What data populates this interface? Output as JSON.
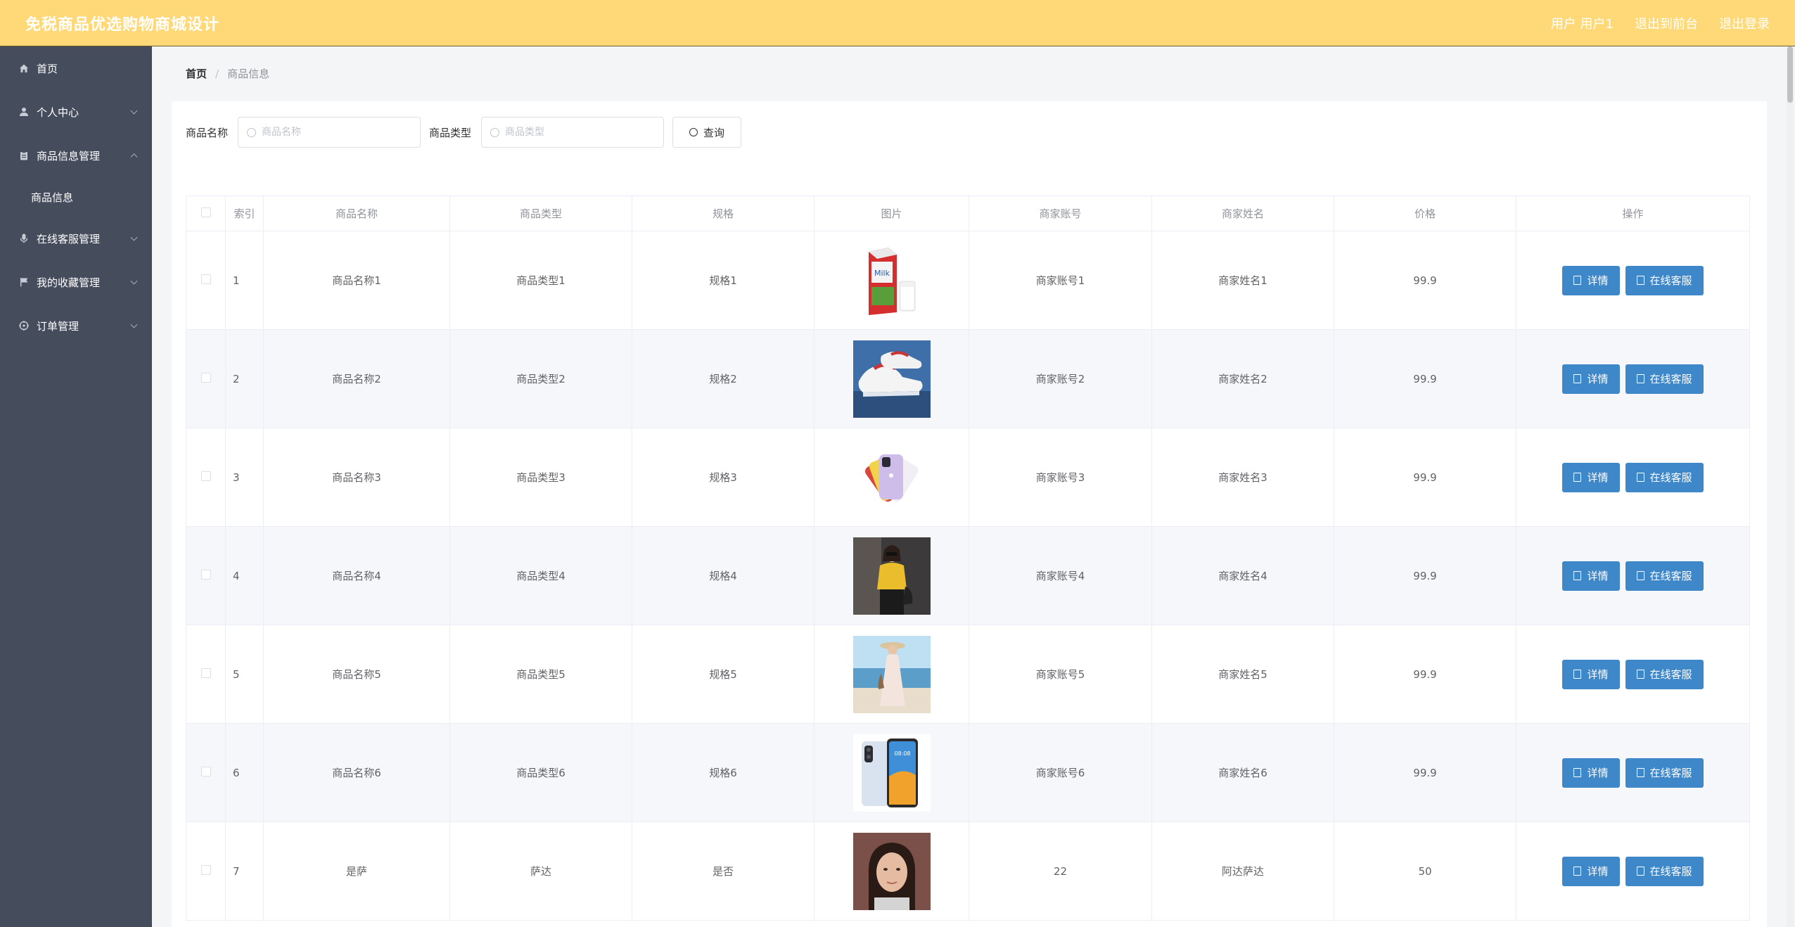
{
  "header": {
    "title": "免税商品优选购物商城设计",
    "user_label": "用户 用户1",
    "back_label": "退出到前台",
    "logout_label": "退出登录"
  },
  "sidebar": {
    "items": [
      {
        "label": "首页",
        "icon": "home-icon"
      },
      {
        "label": "个人中心",
        "icon": "user-icon"
      },
      {
        "label": "商品信息管理",
        "icon": "clipboard-icon"
      },
      {
        "label": "商品信息"
      },
      {
        "label": "在线客服管理",
        "icon": "microphone-icon"
      },
      {
        "label": "我的收藏管理",
        "icon": "flag-icon"
      },
      {
        "label": "订单管理",
        "icon": "compass-icon"
      }
    ]
  },
  "breadcrumb": {
    "home": "首页",
    "separator": "/",
    "current": "商品信息"
  },
  "search": {
    "name_label": "商品名称",
    "name_placeholder": "商品名称",
    "type_label": "商品类型",
    "type_placeholder": "商品类型",
    "query_button": "查询"
  },
  "table": {
    "columns": [
      "索引",
      "商品名称",
      "商品类型",
      "规格",
      "图片",
      "商家账号",
      "商家姓名",
      "价格",
      "操作"
    ],
    "detail_button": "详情",
    "service_button": "在线客服",
    "rows": [
      {
        "index": "1",
        "name": "商品名称1",
        "type": "商品类型1",
        "spec": "规格1",
        "image": "milk-carton",
        "account": "商家账号1",
        "merchant": "商家姓名1",
        "price": "99.9"
      },
      {
        "index": "2",
        "name": "商品名称2",
        "type": "商品类型2",
        "spec": "规格2",
        "image": "sneakers",
        "account": "商家账号2",
        "merchant": "商家姓名2",
        "price": "99.9"
      },
      {
        "index": "3",
        "name": "商品名称3",
        "type": "商品类型3",
        "spec": "规格3",
        "image": "smartphones-fan",
        "account": "商家账号3",
        "merchant": "商家姓名3",
        "price": "99.9"
      },
      {
        "index": "4",
        "name": "商品名称4",
        "type": "商品类型4",
        "spec": "规格4",
        "image": "woman-yellow-top",
        "account": "商家账号4",
        "merchant": "商家姓名4",
        "price": "99.9"
      },
      {
        "index": "5",
        "name": "商品名称5",
        "type": "商品类型5",
        "spec": "规格5",
        "image": "woman-beach-dress",
        "account": "商家账号5",
        "merchant": "商家姓名5",
        "price": "99.9"
      },
      {
        "index": "6",
        "name": "商品名称6",
        "type": "商品类型6",
        "spec": "规格6",
        "image": "smartphone",
        "account": "商家账号6",
        "merchant": "商家姓名6",
        "price": "99.9"
      },
      {
        "index": "7",
        "name": "是萨",
        "type": "萨达",
        "spec": "是否",
        "image": "woman-portrait",
        "account": "22",
        "merchant": "阿达萨达",
        "price": "50"
      }
    ]
  },
  "colors": {
    "header": "#ffd877",
    "sidebar": "#454c5c",
    "primary_button": "#3e87c9"
  }
}
